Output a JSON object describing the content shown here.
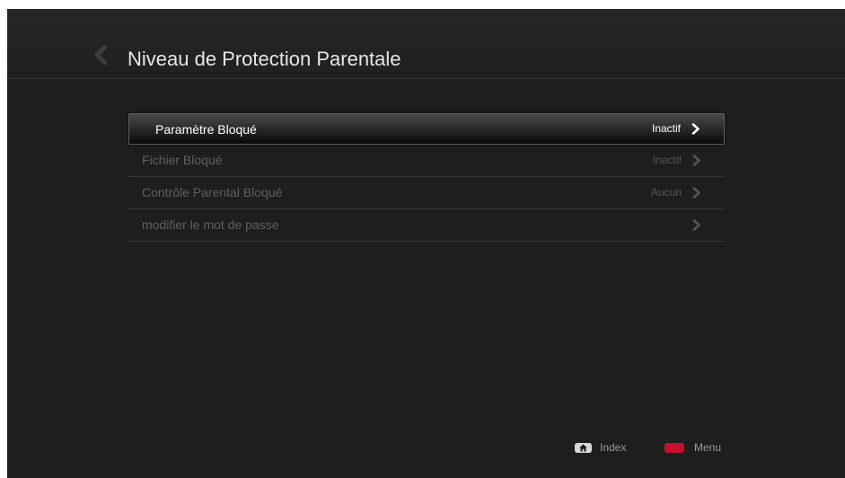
{
  "header": {
    "title": "Niveau de Protection Parentale",
    "back_icon": "chevron-left-icon"
  },
  "menu": {
    "items": [
      {
        "label": "Paramètre Bloqué",
        "value": "Inactif",
        "selected": true
      },
      {
        "label": "Fichier Bloqué",
        "value": "Inactif",
        "selected": false
      },
      {
        "label": "Contrôle Parental Bloqué",
        "value": "Aucun",
        "selected": false
      },
      {
        "label": "modifier le mot de passe",
        "value": "",
        "selected": false
      }
    ]
  },
  "footer": {
    "index_label": "Index",
    "index_icon": "home-icon",
    "menu_label": "Menu",
    "menu_key_color": "#c8102e"
  }
}
